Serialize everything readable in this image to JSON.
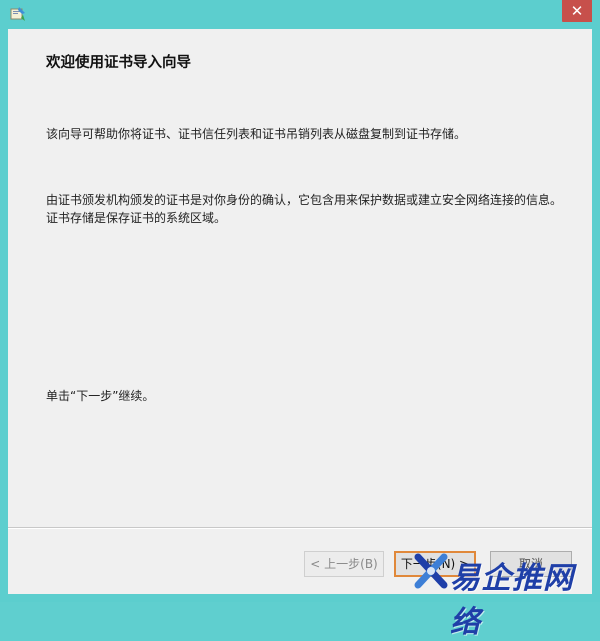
{
  "window": {
    "close_glyph": "✕",
    "app_icon": "certificate-wizard-icon"
  },
  "wizard": {
    "heading": "欢迎使用证书导入向导",
    "paragraph1": "该向导可帮助你将证书、证书信任列表和证书吊销列表从磁盘复制到证书存储。",
    "paragraph2": "由证书颁发机构颁发的证书是对你身份的确认，它包含用来保护数据或建立安全网络连接的信息。证书存储是保存证书的系统区域。",
    "paragraph3": "单击“下一步”继续。"
  },
  "buttons": {
    "back_label": "< 上一步(B)",
    "next_label": "下一步(N) >",
    "cancel_label": "取消"
  },
  "watermark": {
    "text": "易企推网络"
  },
  "colors": {
    "frame": "#5ccece",
    "client_bg": "#f0f0f0",
    "close_button": "#c7504b",
    "next_highlight": "#e0883a",
    "watermark": "#1f3fa8"
  }
}
